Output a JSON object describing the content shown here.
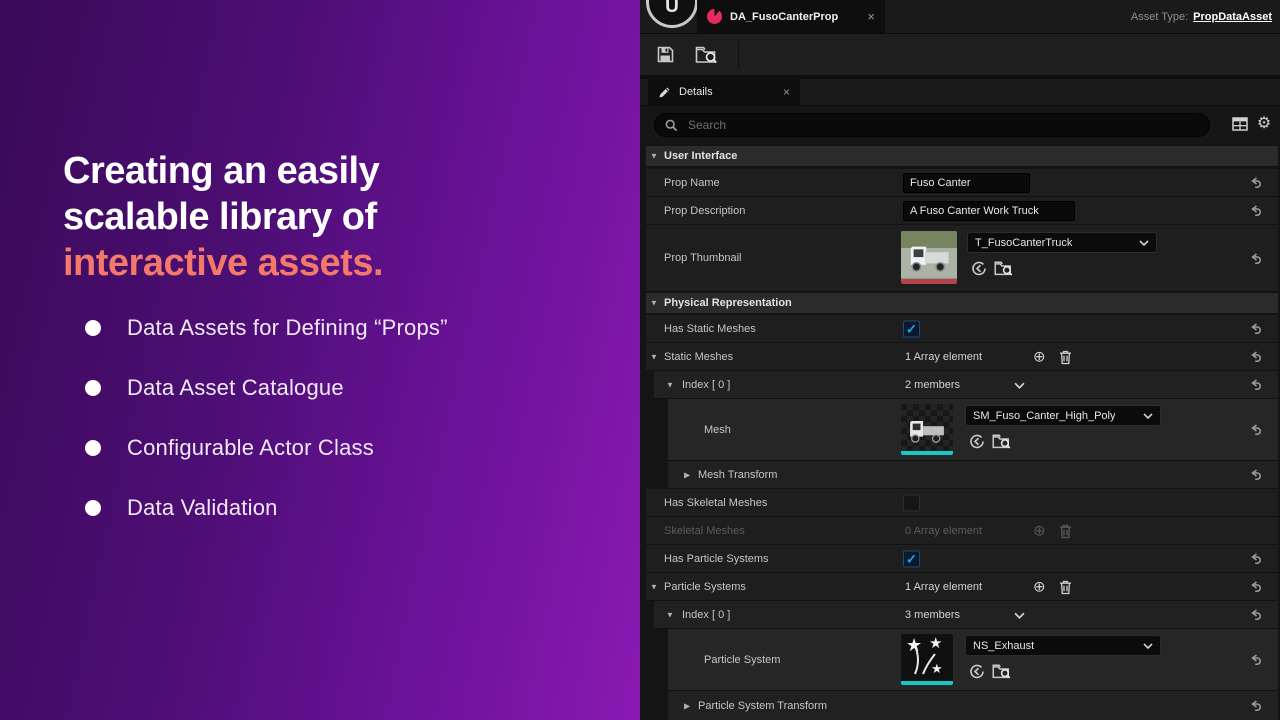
{
  "left_panel": {
    "title_line1": "Creating an easily",
    "title_line2": "scalable library of",
    "title_accent": "interactive assets.",
    "bullets": [
      "Data Assets for Defining “Props”",
      "Data Asset Catalogue",
      "Configurable Actor Class",
      "Data Validation"
    ],
    "colors": {
      "background_dark": "#3a0a58",
      "background_bright": "#8a1ab2",
      "accent": "#f4796b"
    }
  },
  "editor": {
    "window": {
      "logo_glyph": "U",
      "tab_title": "DA_FusoCanterProp",
      "asset_type_label": "Asset Type:",
      "asset_type_value": "PropDataAsset"
    },
    "details": {
      "tab_label": "Details",
      "search_placeholder": "Search"
    },
    "icons": {
      "close": "×",
      "expanded": "▼",
      "collapsed": "▶",
      "check": "✓",
      "add": "⊕",
      "gear": "⚙",
      "star": "★"
    },
    "colors": {
      "checkbox_blue": "#2ba2f2",
      "texture_underline": "#b5434e",
      "mesh_underline": "#17c9c4",
      "tab_icon_pink": "#e8295c"
    },
    "rows": {
      "user_interface": {
        "label": "User Interface"
      },
      "prop_name": {
        "label": "Prop Name",
        "value": "Fuso Canter"
      },
      "prop_description": {
        "label": "Prop Description",
        "value": "A Fuso Canter Work Truck"
      },
      "prop_thumbnail": {
        "label": "Prop Thumbnail",
        "value": "T_FusoCanterTruck"
      },
      "physical_representation": {
        "label": "Physical Representation"
      },
      "has_static_meshes": {
        "label": "Has Static Meshes",
        "checked": true
      },
      "static_meshes": {
        "label": "Static Meshes",
        "value": "1 Array element"
      },
      "static_index": {
        "label": "Index [ 0 ]",
        "value": "2 members"
      },
      "mesh": {
        "label": "Mesh",
        "value": "SM_Fuso_Canter_High_Poly"
      },
      "mesh_transform": {
        "label": "Mesh Transform"
      },
      "has_skeletal_meshes": {
        "label": "Has Skeletal Meshes",
        "checked": false
      },
      "skeletal_meshes": {
        "label": "Skeletal Meshes",
        "value": "0 Array element",
        "disabled": true
      },
      "has_particle_systems": {
        "label": "Has Particle Systems",
        "checked": true
      },
      "particle_systems": {
        "label": "Particle Systems",
        "value": "1 Array element"
      },
      "particle_index": {
        "label": "Index [ 0 ]",
        "value": "3 members"
      },
      "particle_system": {
        "label": "Particle System",
        "value": "NS_Exhaust"
      },
      "particle_system_transform": {
        "label": "Particle System Transform"
      }
    }
  }
}
